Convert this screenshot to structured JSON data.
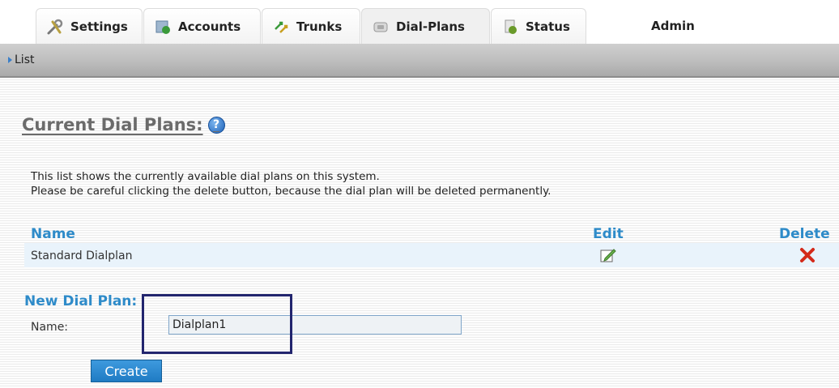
{
  "tabs": [
    {
      "label": "Settings",
      "icon": "wrench-screwdriver-icon"
    },
    {
      "label": "Accounts",
      "icon": "accounts-icon"
    },
    {
      "label": "Trunks",
      "icon": "trunks-arrows-icon"
    },
    {
      "label": "Dial-Plans",
      "icon": "phone-icon"
    },
    {
      "label": "Status",
      "icon": "status-icon"
    },
    {
      "label": "Admin"
    }
  ],
  "subnav": {
    "item": "List"
  },
  "page": {
    "title": "Current Dial Plans:",
    "help_icon": "?",
    "description_line1": "This list shows the currently available dial plans on this system.",
    "description_line2": "Please be careful clicking the delete button, because the dial plan will be deleted permanently."
  },
  "table": {
    "headers": {
      "name": "Name",
      "edit": "Edit",
      "delete": "Delete"
    },
    "rows": [
      {
        "name": "Standard Dialplan"
      }
    ]
  },
  "new_plan": {
    "title": "New Dial Plan:",
    "name_label": "Name:",
    "name_value": "Dialplan1",
    "create_label": "Create"
  },
  "colors": {
    "accent": "#2e8bc9",
    "highlight_box": "#22256e",
    "button": "#2a86cc"
  }
}
